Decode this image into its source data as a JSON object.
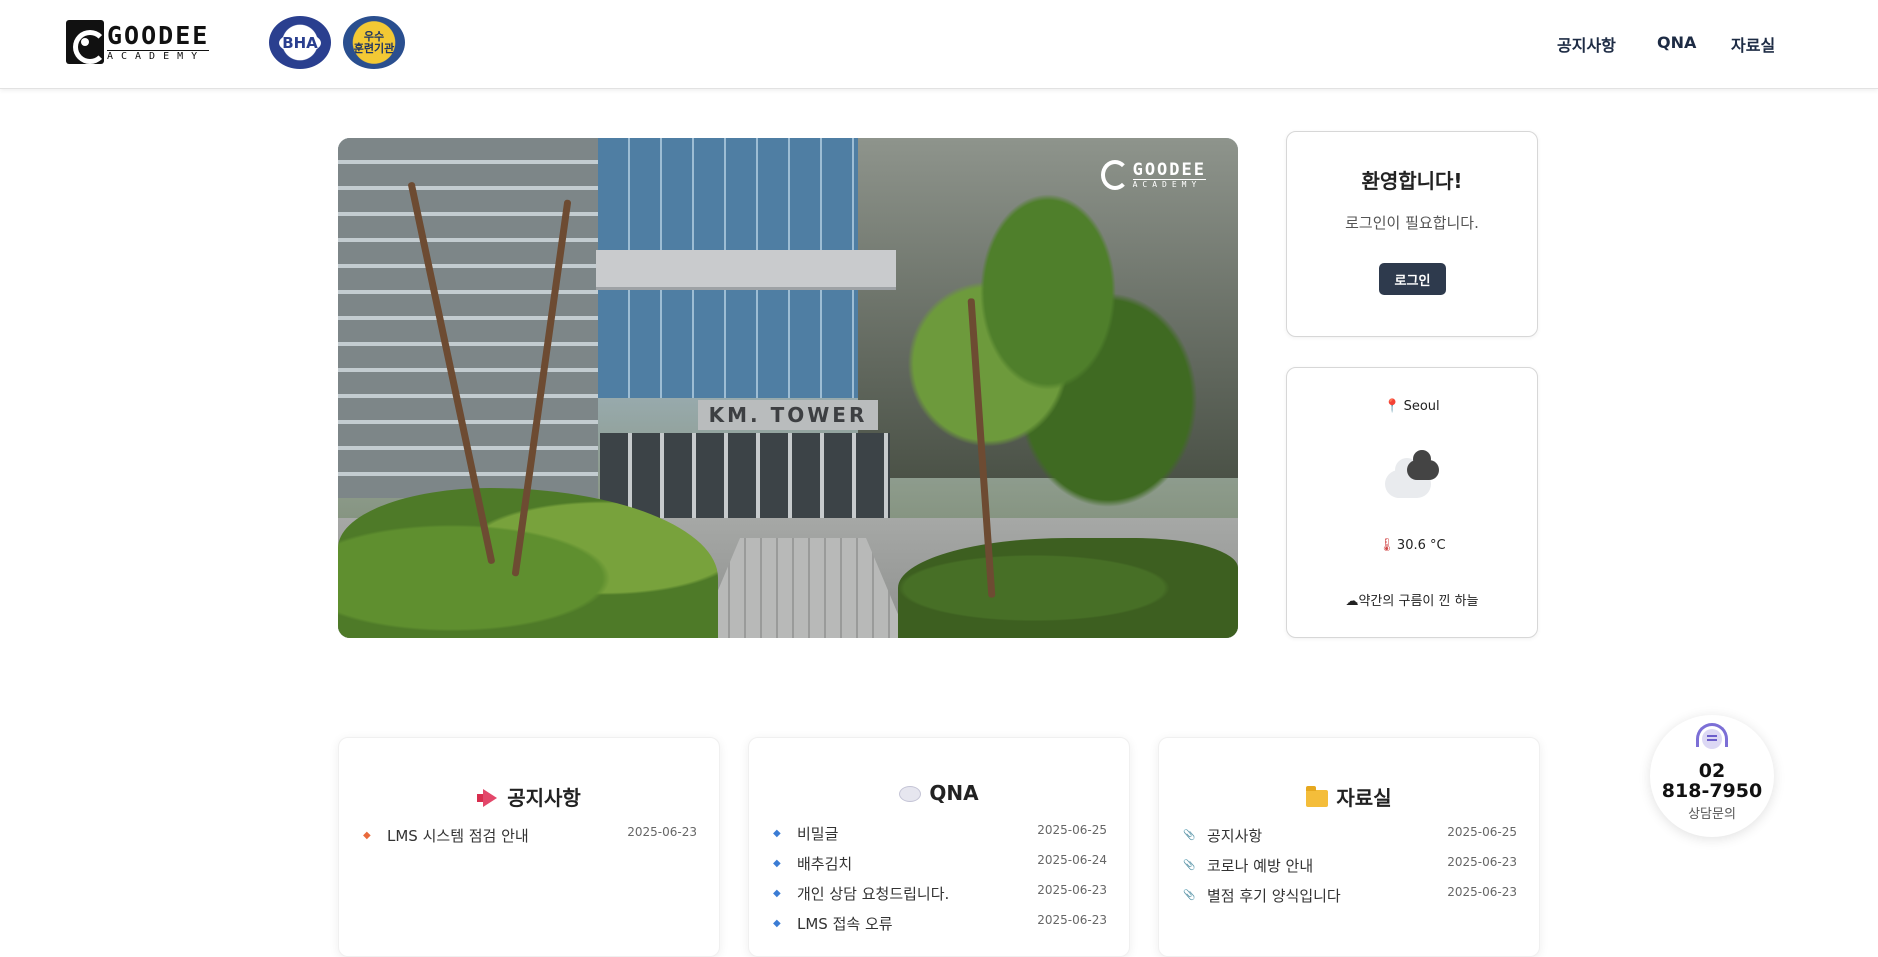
{
  "header": {
    "logo_word": "GOODEE",
    "logo_sub": "ACADEMY",
    "badge_bha": "BHA",
    "badge_award": "우수\n훈련기관",
    "nav": [
      "공지사항",
      "QNA",
      "자료실"
    ]
  },
  "hero": {
    "sign": "KM. TOWER",
    "logo_word": "GOODEE",
    "logo_sub": "ACADEMY"
  },
  "login": {
    "title": "환영합니다!",
    "message": "로그인이 필요합니다.",
    "button": "로그인"
  },
  "weather": {
    "city": "Seoul",
    "temperature": "30.6 °C",
    "description": "약간의 구름이 낀 하늘"
  },
  "boards": {
    "notice": {
      "title": "공지사항",
      "items": [
        {
          "title": "LMS 시스템 점검 안내",
          "date": "2025-06-23"
        }
      ]
    },
    "qna": {
      "title": "QNA",
      "items": [
        {
          "title": "비밀글",
          "date": "2025-06-25"
        },
        {
          "title": "배추김치",
          "date": "2025-06-24"
        },
        {
          "title": "개인 상담 요청드립니다.",
          "date": "2025-06-23"
        },
        {
          "title": "LMS 접속 오류",
          "date": "2025-06-23"
        }
      ]
    },
    "archive": {
      "title": "자료실",
      "items": [
        {
          "title": "공지사항",
          "date": "2025-06-25"
        },
        {
          "title": "코로나 예방 안내",
          "date": "2025-06-23"
        },
        {
          "title": "별점 후기 양식입니다",
          "date": "2025-06-23"
        }
      ]
    }
  },
  "contact": {
    "phone_line1": "02",
    "phone_line2": "818-7950",
    "label": "상담문의"
  },
  "colors": {
    "nav_text": "#1d2b44",
    "login_button": "#2e3a4d",
    "notice_bullet": "#e96a3c",
    "qna_bullet": "#3b7cd4"
  },
  "icons": [
    "megaphone-icon",
    "speech-bubble-icon",
    "folder-icon",
    "paperclip-icon",
    "pin-icon",
    "thermometer-icon",
    "cloud-icon",
    "headset-icon"
  ]
}
